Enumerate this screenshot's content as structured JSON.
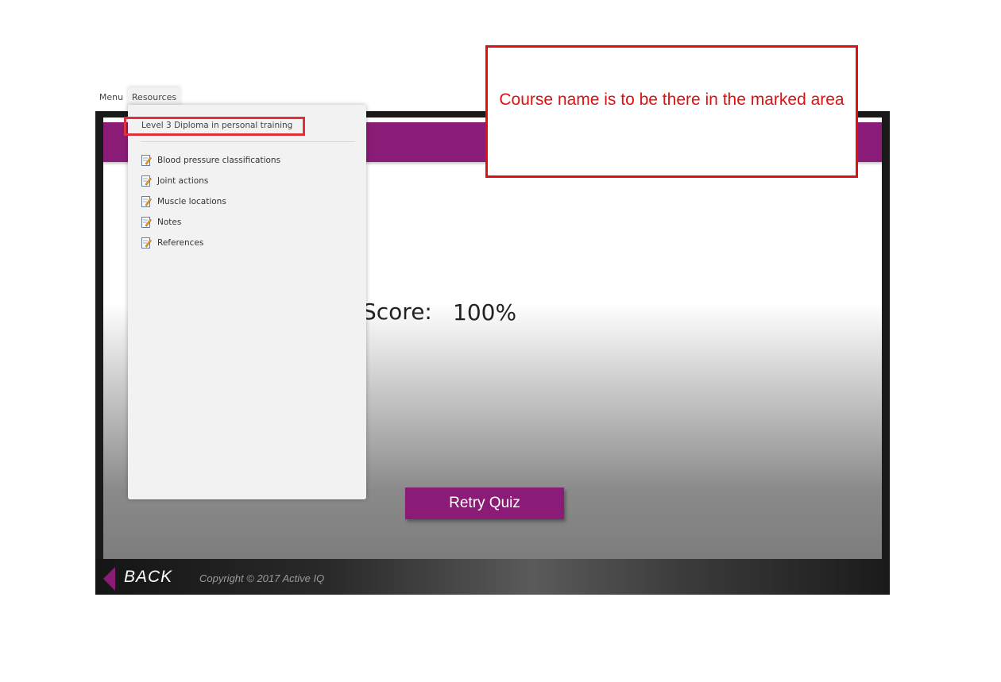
{
  "tabs": {
    "menu": "Menu",
    "resources": "Resources"
  },
  "resources_panel": {
    "course_name": "Level 3 Diploma in personal training",
    "items": [
      {
        "label": "Blood pressure classifications",
        "icon": "document-edit-icon"
      },
      {
        "label": "Joint actions",
        "icon": "document-edit-icon"
      },
      {
        "label": "Muscle locations",
        "icon": "document-edit-icon"
      },
      {
        "label": "Notes",
        "icon": "document-edit-icon"
      },
      {
        "label": "References",
        "icon": "document-edit-icon"
      }
    ]
  },
  "quiz": {
    "score_label": "Score:",
    "score_value": "100%",
    "retry_label": "Retry Quiz"
  },
  "footer": {
    "back_label": "BACK",
    "copyright": "Copyright © 2017 Active IQ"
  },
  "annotation": {
    "note": "Course name is to be there in the marked area"
  },
  "colors": {
    "brand_purple": "#8a1c77",
    "annotation_red": "#dd1111",
    "panel_bg": "#f2f2f2"
  }
}
